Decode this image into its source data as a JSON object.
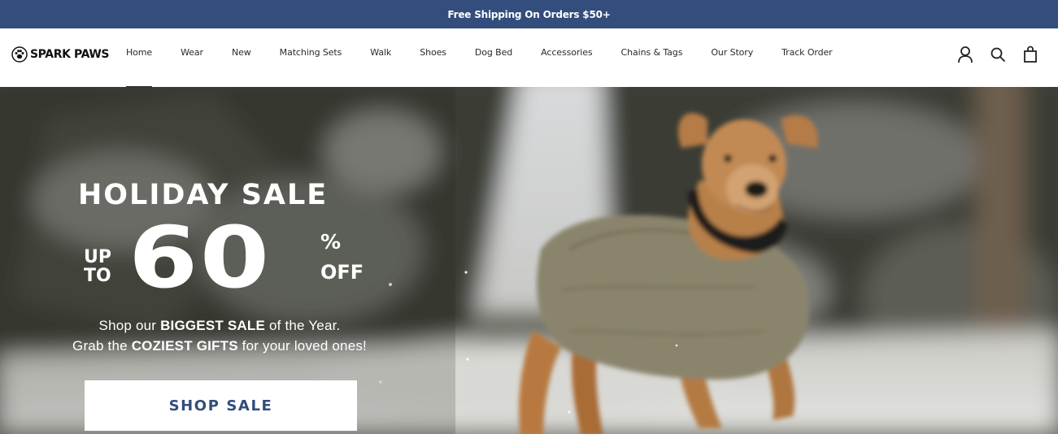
{
  "announcement": {
    "text": "Free Shipping On Orders $50+"
  },
  "brand": {
    "name": "SPARK PAWS"
  },
  "nav": {
    "items": [
      {
        "label": "Home",
        "active": true
      },
      {
        "label": "Wear"
      },
      {
        "label": "New"
      },
      {
        "label": "Matching Sets"
      },
      {
        "label": "Walk"
      },
      {
        "label": "Shoes"
      },
      {
        "label": "Dog Bed"
      },
      {
        "label": "Accessories"
      },
      {
        "label": "Chains & Tags"
      },
      {
        "label": "Our Story"
      },
      {
        "label": "Track Order"
      }
    ]
  },
  "header_icons": [
    "account-icon",
    "search-icon",
    "cart-icon"
  ],
  "hero": {
    "headline": "HOLIDAY SALE",
    "up": "UP",
    "to": "TO",
    "amount": "60",
    "percent": "%",
    "off": "OFF",
    "sub1_pre": "Shop our ",
    "sub1_bold": "BIGGEST SALE",
    "sub1_post": " of the Year.",
    "sub2_pre": "Grab the ",
    "sub2_bold": "COZIEST GIFTS",
    "sub2_post": " for your loved ones!",
    "cta": "SHOP SALE"
  },
  "colors": {
    "brand_navy": "#334d7c",
    "text_dark": "#2a2a2a",
    "white": "#ffffff"
  }
}
